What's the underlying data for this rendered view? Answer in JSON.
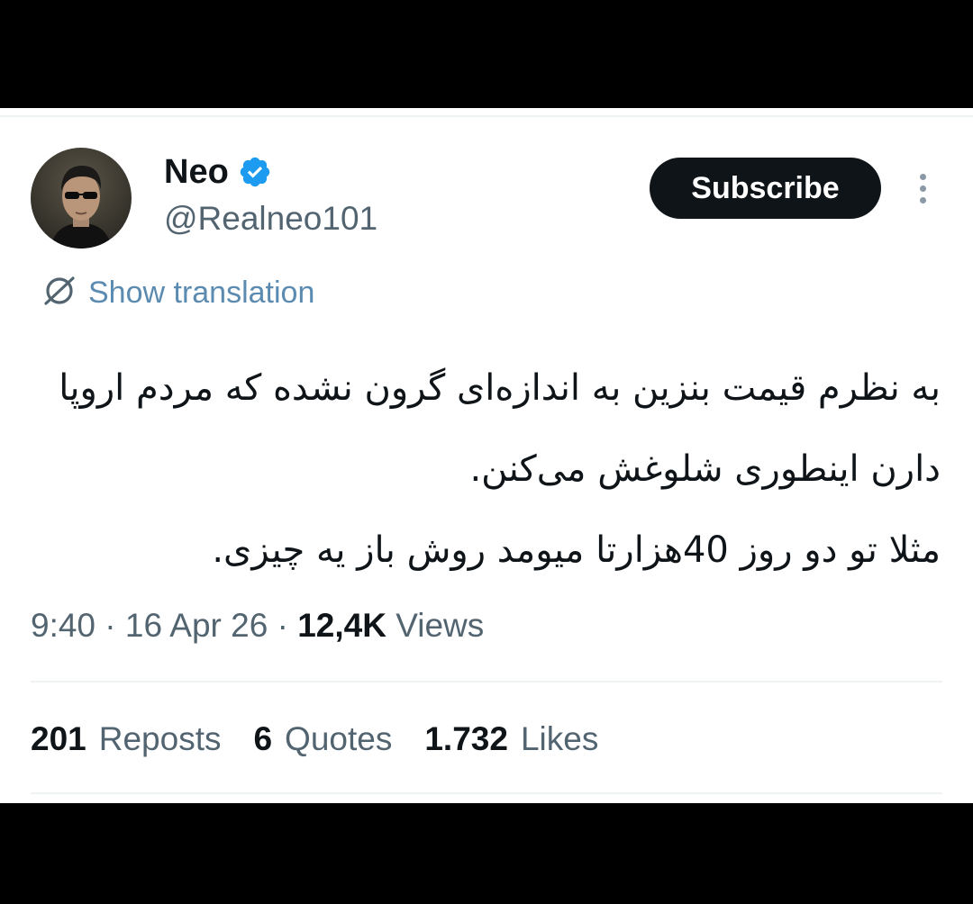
{
  "author": {
    "display_name": "Neo",
    "handle": "@Realneo101"
  },
  "actions": {
    "subscribe_label": "Subscribe",
    "show_translation_label": "Show translation"
  },
  "tweet": {
    "paragraph_1": "به نظرم قیمت بنزین به اندازه‌ای گرون نشده که مردم اروپا دارن اینطوری شلوغش می‌کنن.",
    "paragraph_2": "مثلا تو دو روز 40هزارتا میومد روش باز یه چیزی."
  },
  "meta": {
    "time": "9:40",
    "separator": "·",
    "date": "16 Apr 26",
    "views_count": "12,4K",
    "views_label": "Views"
  },
  "stats": {
    "reposts_count": "201",
    "reposts_label": "Reposts",
    "quotes_count": "6",
    "quotes_label": "Quotes",
    "likes_count": "1.732",
    "likes_label": "Likes"
  },
  "icons": {
    "verified": "verified-badge-icon",
    "translate": "translate-icon",
    "more": "more-options-icon"
  },
  "colors": {
    "verified": "#1d9bf0",
    "link": "#5b8bb0",
    "secondary_text": "#536471",
    "primary_text": "#0f1419",
    "button_bg": "#0f1419"
  }
}
